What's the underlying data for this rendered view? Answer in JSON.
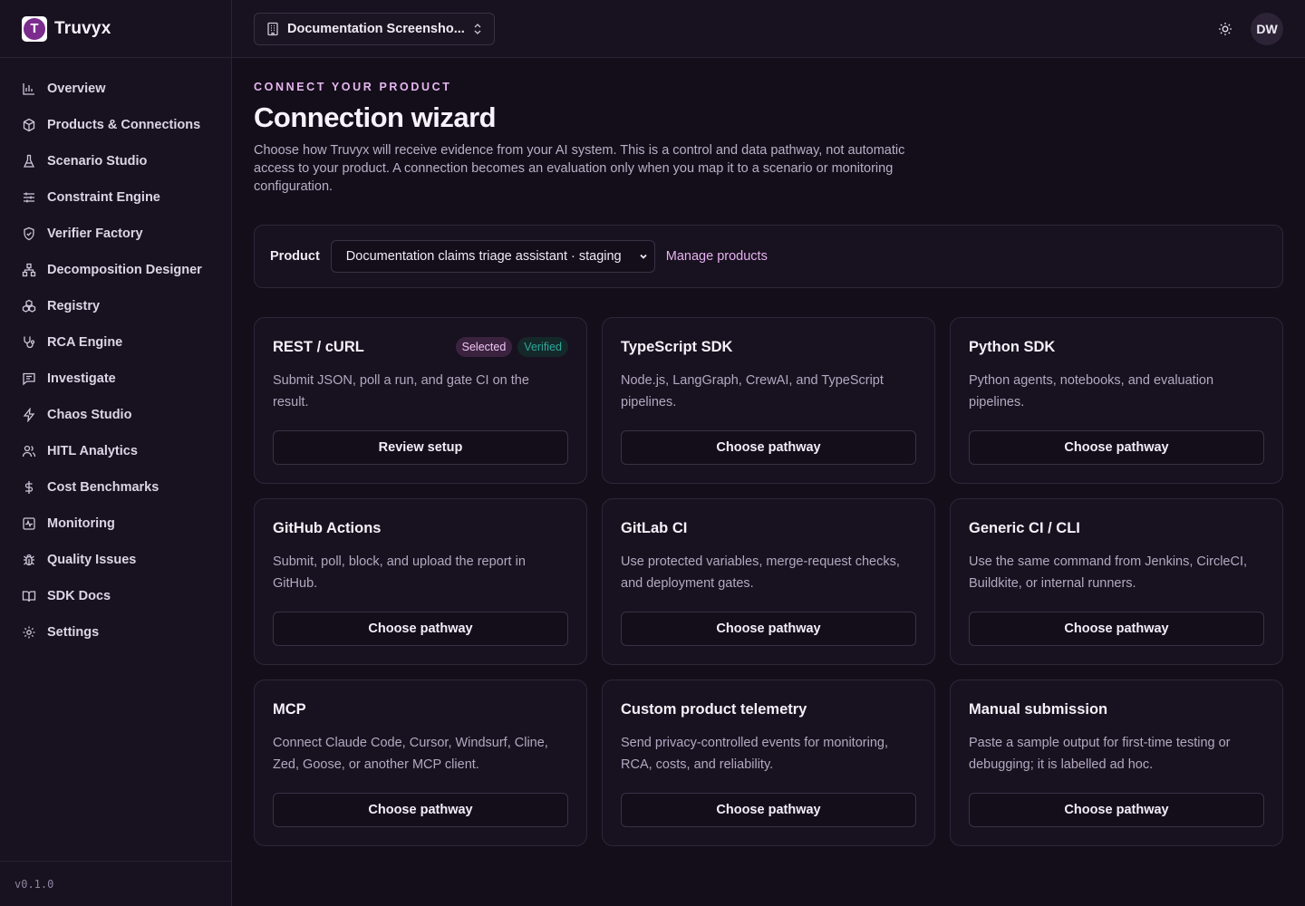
{
  "app": {
    "name": "Truvyx",
    "version": "v0.1.0"
  },
  "sidebar": {
    "items": [
      {
        "label": "Overview",
        "icon": "bar-chart-icon"
      },
      {
        "label": "Products & Connections",
        "icon": "package-icon"
      },
      {
        "label": "Scenario Studio",
        "icon": "flask-icon"
      },
      {
        "label": "Constraint Engine",
        "icon": "sliders-icon"
      },
      {
        "label": "Verifier Factory",
        "icon": "shield-check-icon"
      },
      {
        "label": "Decomposition Designer",
        "icon": "network-icon"
      },
      {
        "label": "Registry",
        "icon": "boxes-icon"
      },
      {
        "label": "RCA Engine",
        "icon": "stethoscope-icon"
      },
      {
        "label": "Investigate",
        "icon": "message-square-icon"
      },
      {
        "label": "Chaos Studio",
        "icon": "zap-icon"
      },
      {
        "label": "HITL Analytics",
        "icon": "users-icon"
      },
      {
        "label": "Cost Benchmarks",
        "icon": "dollar-icon"
      },
      {
        "label": "Monitoring",
        "icon": "activity-icon"
      },
      {
        "label": "Quality Issues",
        "icon": "bug-icon"
      },
      {
        "label": "SDK Docs",
        "icon": "book-open-icon"
      },
      {
        "label": "Settings",
        "icon": "gear-icon"
      }
    ]
  },
  "topbar": {
    "workspace": "Documentation Screensho...",
    "avatar_initials": "DW"
  },
  "main": {
    "eyebrow": "CONNECT YOUR PRODUCT",
    "title": "Connection wizard",
    "description": "Choose how Truvyx will receive evidence from your AI system. This is a control and data pathway, not automatic access to your product. A connection becomes an evaluation only when you map it to a scenario or monitoring configuration.",
    "product": {
      "label": "Product",
      "selected": "Documentation claims triage assistant · staging",
      "manage_link": "Manage products"
    },
    "cards": [
      {
        "title": "REST / cURL",
        "description": "Submit JSON, poll a run, and gate CI on the result.",
        "button": "Review setup",
        "badges": [
          "Selected",
          "Verified"
        ]
      },
      {
        "title": "TypeScript SDK",
        "description": "Node.js, LangGraph, CrewAI, and TypeScript pipelines.",
        "button": "Choose pathway"
      },
      {
        "title": "Python SDK",
        "description": "Python agents, notebooks, and evaluation pipelines.",
        "button": "Choose pathway"
      },
      {
        "title": "GitHub Actions",
        "description": "Submit, poll, block, and upload the report in GitHub.",
        "button": "Choose pathway"
      },
      {
        "title": "GitLab CI",
        "description": "Use protected variables, merge-request checks, and deployment gates.",
        "button": "Choose pathway"
      },
      {
        "title": "Generic CI / CLI",
        "description": "Use the same command from Jenkins, CircleCI, Buildkite, or internal runners.",
        "button": "Choose pathway"
      },
      {
        "title": "MCP",
        "description": "Connect Claude Code, Cursor, Windsurf, Cline, Zed, Goose, or another MCP client.",
        "button": "Choose pathway"
      },
      {
        "title": "Custom product telemetry",
        "description": "Send privacy-controlled events for monitoring, RCA, costs, and reliability.",
        "button": "Choose pathway"
      },
      {
        "title": "Manual submission",
        "description": "Paste a sample output for first-time testing or debugging; it is labelled ad hoc.",
        "button": "Choose pathway"
      }
    ]
  },
  "colors": {
    "accent": "#e6b2f0",
    "background": "#140e1b",
    "verified": "#2fa89a"
  }
}
